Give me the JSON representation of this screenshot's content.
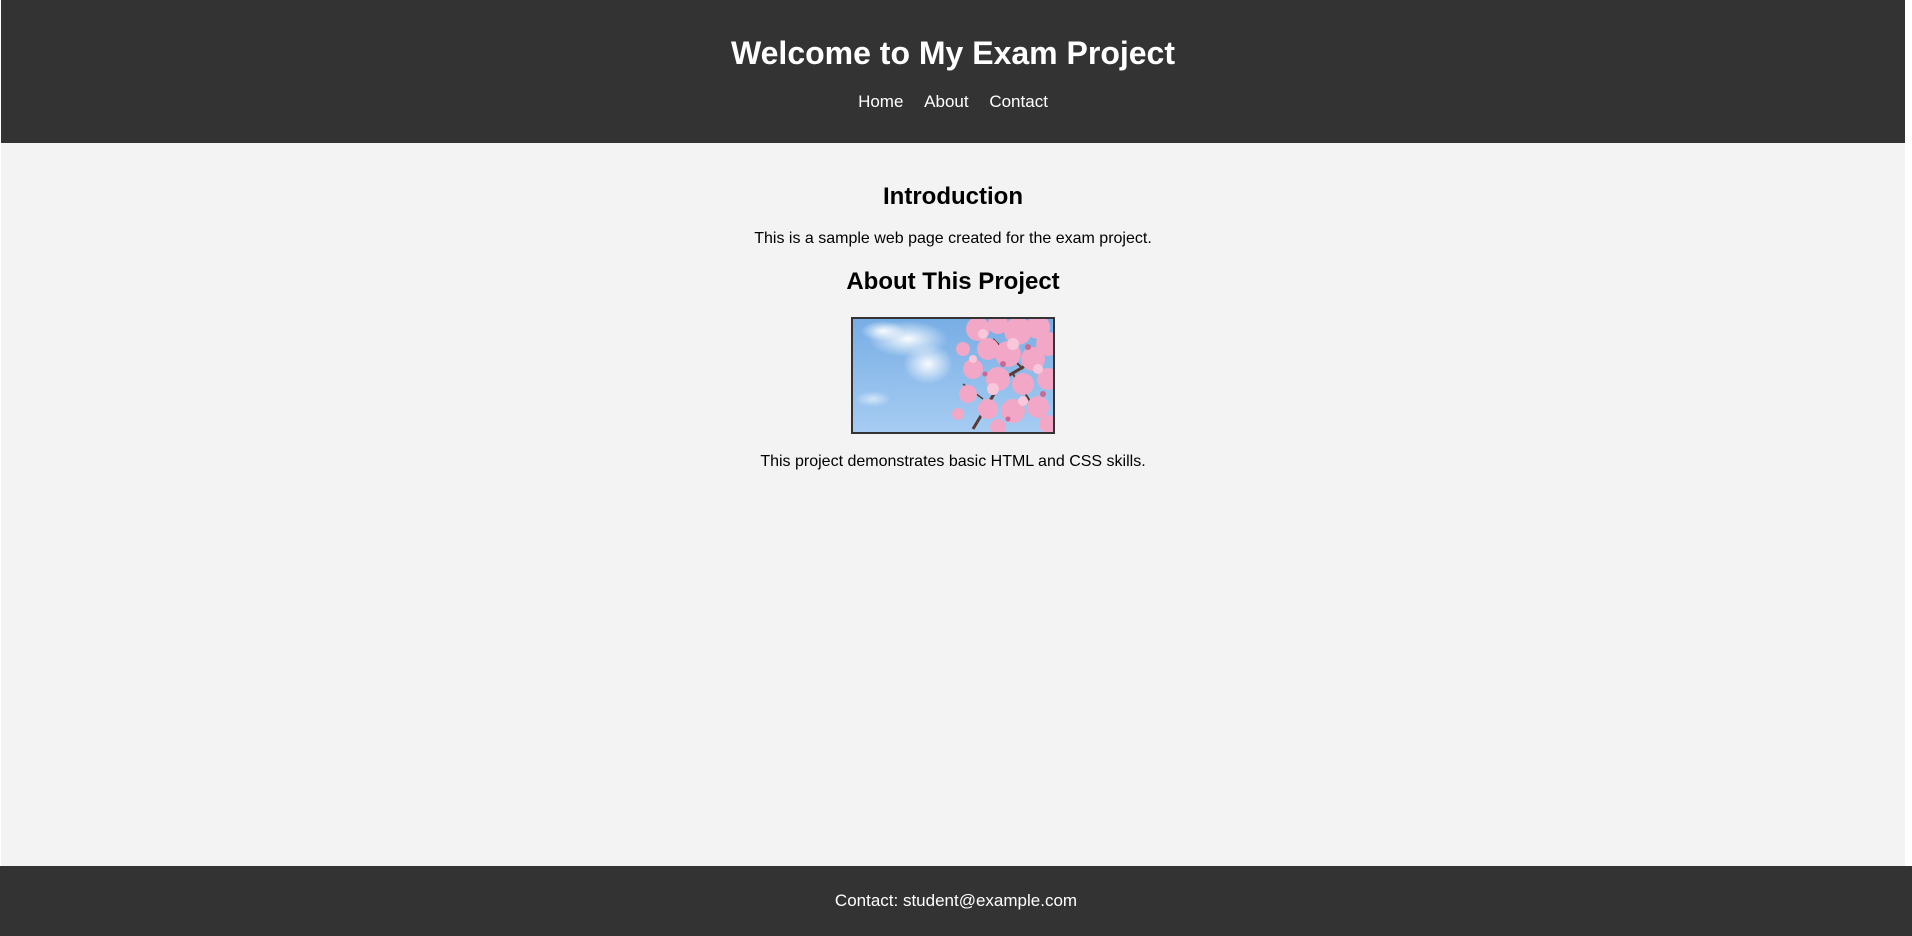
{
  "header": {
    "title": "Welcome to My Exam Project",
    "nav": [
      {
        "label": "Home"
      },
      {
        "label": "About"
      },
      {
        "label": "Contact"
      }
    ]
  },
  "sections": {
    "introduction": {
      "heading": "Introduction",
      "text": "This is a sample web page created for the exam project."
    },
    "about": {
      "heading": "About This Project",
      "image_subject": "cherry-blossom-sky-photo",
      "text": "This project demonstrates basic HTML and CSS skills."
    }
  },
  "footer": {
    "contact": "Contact: student@example.com"
  },
  "colors": {
    "header_bg": "#333333",
    "page_bg": "#f3f3f3",
    "footer_bg": "#333333",
    "text_light": "#ffffff",
    "text_dark": "#000000"
  }
}
